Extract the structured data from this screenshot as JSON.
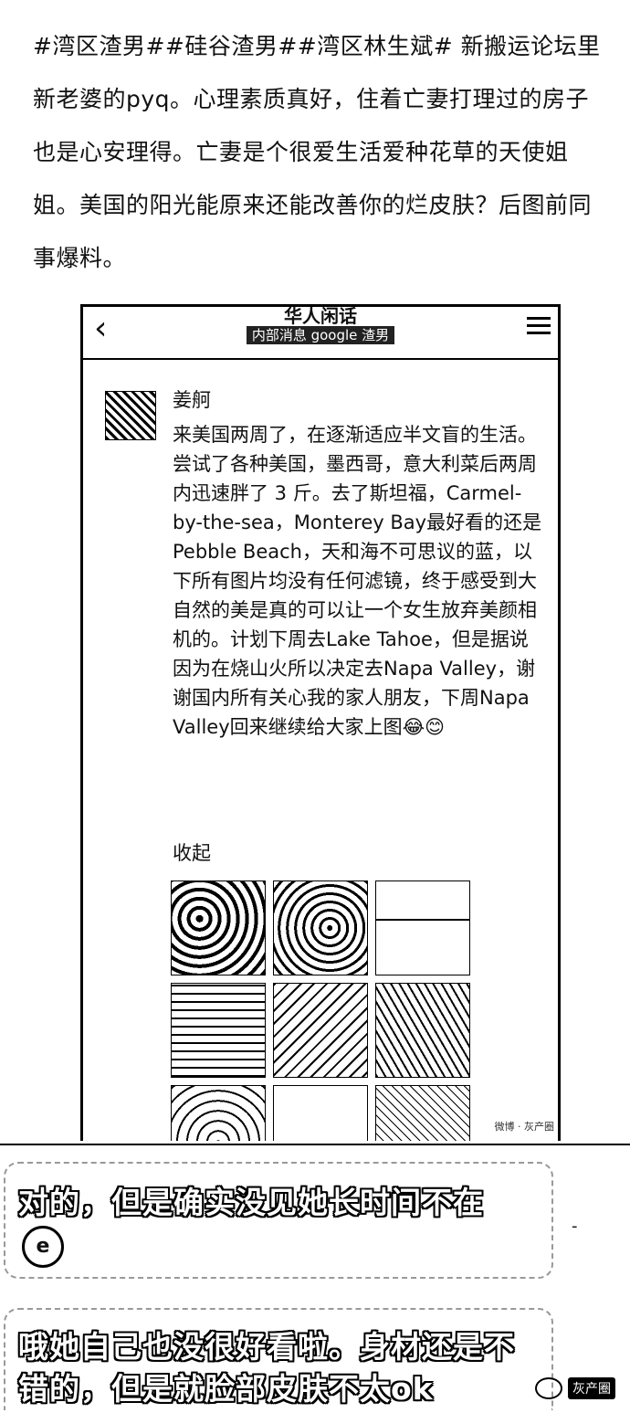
{
  "post": {
    "text": "#湾区渣男##硅谷渣男##湾区林生斌# 新搬运论坛里新老婆的pyq。心理素质真好，住着亡妻打理过的房子也是心安理得。亡妻是个很爱生活爱种花草的天使姐姐。美国的阳光能原来还能改善你的烂皮肤？后图前同事爆料。"
  },
  "screenshot": {
    "header_title": "华人闲话",
    "header_subtitle": "内部消息 google 渣男",
    "author": "姜舸",
    "body": "来美国两周了，在逐渐适应半文盲的生活。尝试了各种美国，墨西哥，意大利菜后两周内迅速胖了 3 斤。去了斯坦福，Carmel-by-the-sea，Monterey Bay最好看的还是Pebble Beach，天和海不可思议的蓝，以下所有图片均没有任何滤镜，终于感受到大自然的美是真的可以让一个女生放弃美颜相机的。计划下周去Lake Tahoe，但是据说因为在烧山火所以决定去Napa Valley，谢谢国内所有关心我的家人朋友，下周Napa Valley回来继续给大家上图😂😊",
    "collapse_label": "收起",
    "watermark": "微博 · 灰产圈"
  },
  "chat": {
    "message_1": "对的，但是确实没见她长时间不在",
    "message_2": "哦她自己也没很好看啦。身材还是不错的，但是就脸部皮肤不太ok"
  },
  "footer": {
    "brand": "灰产圈"
  }
}
